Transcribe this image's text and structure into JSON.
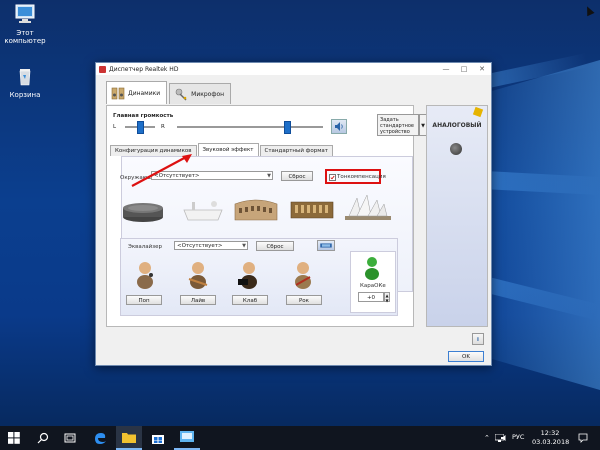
{
  "desktop": {
    "icons": [
      {
        "label": "Этот компьютер",
        "icon": "computer-icon"
      },
      {
        "label": "Корзина",
        "icon": "recycle-bin-icon"
      }
    ]
  },
  "window": {
    "title": "Диспетчер Realtek HD",
    "controls": {
      "minimize": "—",
      "maximize": "□",
      "close": "✕"
    },
    "main_tabs": [
      {
        "label": "Динамики",
        "active": true
      },
      {
        "label": "Микрофон",
        "active": false
      }
    ],
    "volume": {
      "label": "Главная громкость",
      "left": "L",
      "right": "R",
      "balance_fraction": 0.5,
      "volume_fraction": 0.75
    },
    "default_device": {
      "label": "Задать стандартное устройство",
      "arrow": "▼"
    },
    "sub_tabs": [
      {
        "label": "Конфигурация динамиков",
        "active": false
      },
      {
        "label": "Звуковой эффект",
        "active": true
      },
      {
        "label": "Стандартный формат",
        "active": false
      }
    ],
    "environment": {
      "label": "Окружающая обста...",
      "selected": "<Отсутствует>",
      "reset": "Сброс"
    },
    "loudness": {
      "label": "Тонкомпенсация",
      "checked": true
    },
    "environments": [
      "stone-room-icon",
      "bathroom-icon",
      "colosseum-icon",
      "arena-icon",
      "opera-house-icon"
    ],
    "equalizer": {
      "label": "Эквалайзер",
      "selected": "<Отсутствует>",
      "reset": "Сброс",
      "presets": [
        "Поп",
        "Лайв",
        "Клаб",
        "Рок"
      ]
    },
    "karaoke": {
      "label": "КараОКе",
      "value": "+0"
    },
    "right_panel": {
      "label": "АНАЛОГОВЫЙ"
    },
    "ok": "OK",
    "info": "i"
  },
  "taskbar": {
    "lang": "РУС",
    "time": "12:32",
    "date": "03.03.2018"
  },
  "colors": {
    "accent": "#1e6fc8",
    "highlight": "#d11111",
    "taskbar": "#10151f"
  }
}
